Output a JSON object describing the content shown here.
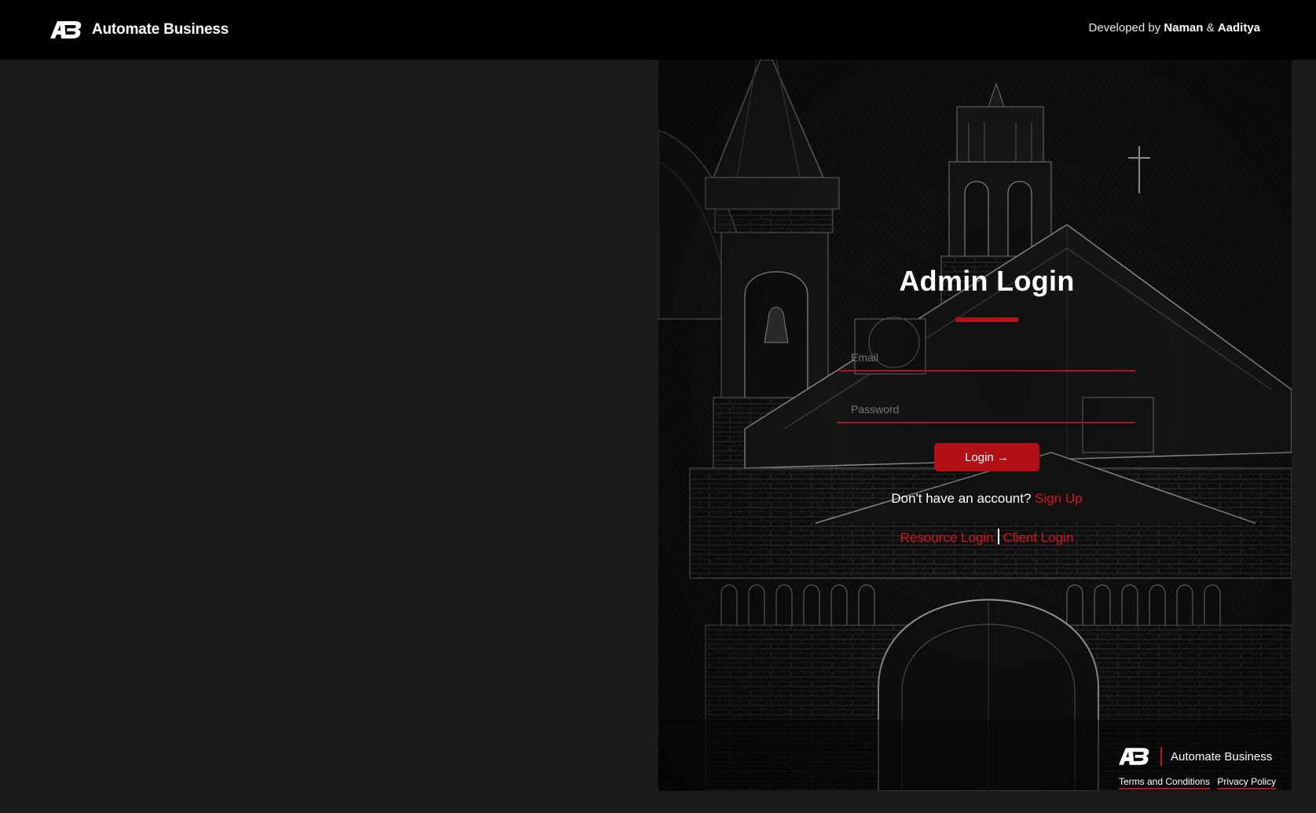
{
  "header": {
    "brand_name": "Automate Business",
    "credits_prefix": "Developed by",
    "credits_name1": "Naman",
    "credits_amp": "&",
    "credits_name2": "Aaditya"
  },
  "login": {
    "title": "Admin Login",
    "email_placeholder": "Email",
    "password_placeholder": "Password",
    "login_button": "Login →",
    "no_account_text": "Don't have an account?",
    "signup_link": "Sign Up",
    "resource_login": "Resource Login",
    "client_login": "Client Login"
  },
  "footer": {
    "brand_name": "Automate Business",
    "terms": "Terms and Conditions",
    "privacy": "Privacy Policy"
  },
  "colors": {
    "accent_red": "#b0141a",
    "header_bg": "#000000",
    "left_panel_bg": "#1b1b1b"
  },
  "icons": {
    "brand_logo": "ab-logo-icon",
    "background_art": "church-sketch"
  }
}
